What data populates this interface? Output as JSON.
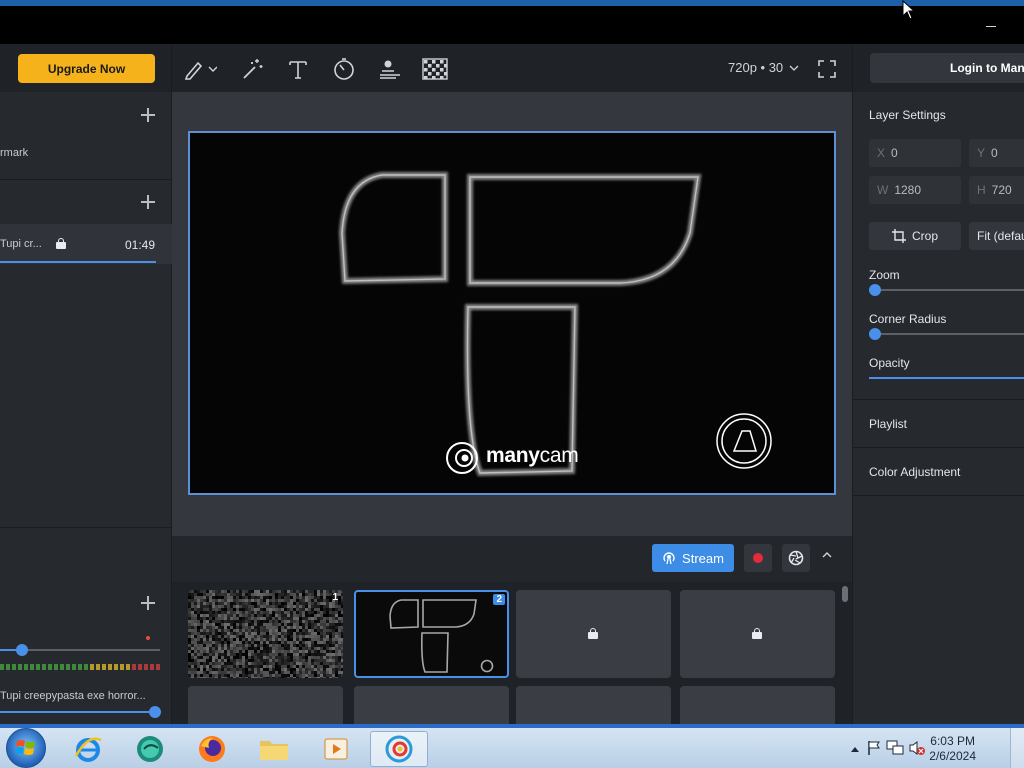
{
  "window": {
    "minimize_label": "—"
  },
  "left_panel": {
    "upgrade_label": "Upgrade Now",
    "presets": {
      "item_label": "rmark"
    },
    "videos": {
      "item_title": "Tupi cr...",
      "item_duration": "01:49"
    },
    "audio": {
      "source_label": "Tupi creepypasta exe horror..."
    }
  },
  "toolbar": {
    "icons": [
      "draw-icon",
      "magic-wand-icon",
      "text-icon",
      "timer-icon",
      "lower-thirds-icon",
      "chroma-key-icon",
      "fullscreen-icon"
    ],
    "resolution_label": "720p • 30"
  },
  "preview": {
    "watermark_bold": "many",
    "watermark_light": "cam"
  },
  "controls": {
    "stream_label": "Stream"
  },
  "sources": {
    "tiles": [
      {
        "number": "1",
        "state": "noise"
      },
      {
        "number": "2",
        "state": "active"
      },
      {
        "number": "",
        "state": "locked"
      },
      {
        "number": "",
        "state": "locked"
      }
    ]
  },
  "right_panel": {
    "login_label": "Login to Many",
    "layer_settings_title": "Layer Settings",
    "x_label": "X",
    "x_value": "0",
    "y_label": "Y",
    "y_value": "0",
    "w_label": "W",
    "w_value": "1280",
    "h_label": "H",
    "h_value": "720",
    "crop_label": "Crop",
    "fit_label": "Fit (defau",
    "zoom_label": "Zoom",
    "corner_radius_label": "Corner Radius",
    "opacity_label": "Opacity",
    "playlist_label": "Playlist",
    "color_adjustment_label": "Color Adjustment"
  },
  "taskbar": {
    "apps": [
      "internet-explorer",
      "app-green",
      "firefox",
      "file-explorer",
      "media-player",
      "manycam"
    ],
    "time": "6:03 PM",
    "date": "2/6/2024"
  },
  "colors": {
    "accent": "#4a8fe8",
    "upgrade": "#f5b21b",
    "record": "#e52a3a"
  }
}
